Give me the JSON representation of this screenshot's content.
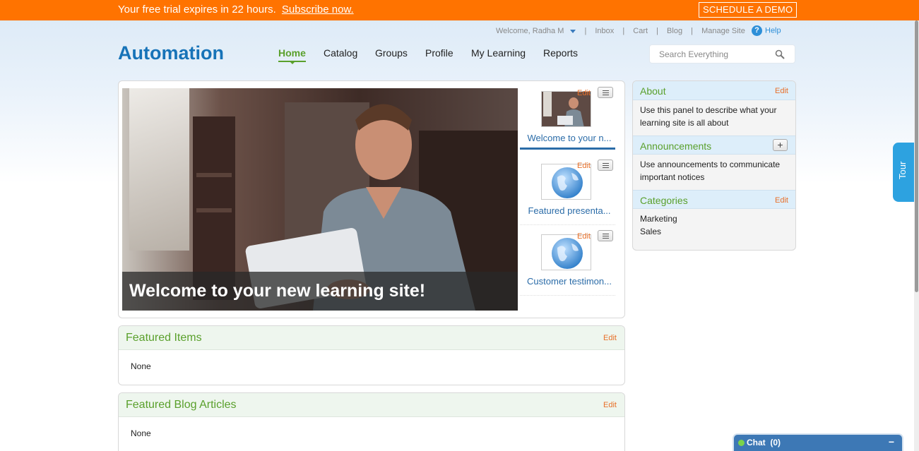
{
  "trial_banner": {
    "message": "Your free trial expires in 22 hours.",
    "link": "Subscribe now.",
    "demo_button": "SCHEDULE A DEMO"
  },
  "util_nav": {
    "welcome": "Welcome, Radha M",
    "links": [
      "Inbox",
      "Cart",
      "Blog",
      "Manage Site"
    ],
    "separator": "|",
    "help": "Help"
  },
  "logo": "Automation",
  "main_nav": {
    "items": [
      "Home",
      "Catalog",
      "Groups",
      "Profile",
      "My Learning",
      "Reports"
    ],
    "active": "Home"
  },
  "search": {
    "placeholder": "Search Everything"
  },
  "hero": {
    "caption": "Welcome to your new learning site!",
    "thumbnails": [
      {
        "title": "Welcome to your n...",
        "edit": "Edit",
        "selected": true
      },
      {
        "title": "Featured presenta...",
        "edit": "Edit",
        "selected": false
      },
      {
        "title": "Customer testimon...",
        "edit": "Edit",
        "selected": false
      }
    ]
  },
  "featured_items": {
    "title": "Featured Items",
    "edit": "Edit",
    "content": "None"
  },
  "featured_blog": {
    "title": "Featured Blog Articles",
    "edit": "Edit",
    "content": "None"
  },
  "sidebar": {
    "about": {
      "title": "About",
      "edit": "Edit",
      "text": "Use this panel to describe what your learning site is all about"
    },
    "announcements": {
      "title": "Announcements",
      "add": "+",
      "text": "Use announcements to communicate important notices"
    },
    "categories": {
      "title": "Categories",
      "edit": "Edit",
      "items": [
        "Marketing",
        "Sales"
      ]
    }
  },
  "tour": "Tour",
  "chat": {
    "label": "Chat",
    "count": "(0)",
    "minimize": "−"
  },
  "colors": {
    "banner": "#ff7300",
    "brand_blue": "#1773b8",
    "accent_green": "#5aa02c",
    "edit_orange": "#e8702a",
    "tour_blue": "#2da2e0",
    "chat_blue": "#3d78b5"
  },
  "icons": [
    "chevron-down-icon",
    "help-icon",
    "search-icon",
    "menu-icon",
    "globe-icon",
    "plus-icon",
    "online-status-icon",
    "minimize-icon"
  ]
}
